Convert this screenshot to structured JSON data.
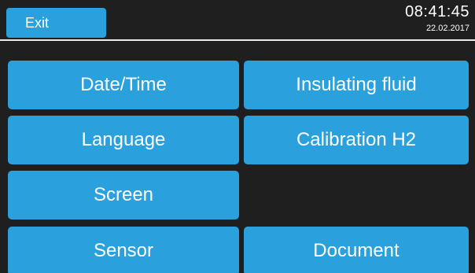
{
  "header": {
    "exit_label": "Exit",
    "time": "08:41:45",
    "date": "22.02.2017"
  },
  "menu": {
    "date_time": "Date/Time",
    "insulating_fluid": "Insulating fluid",
    "language": "Language",
    "calibration_h2": "Calibration H2",
    "screen": "Screen",
    "sensor": "Sensor",
    "document": "Document"
  },
  "colors": {
    "accent": "#2aa0dc",
    "background": "#1f1f1f",
    "text": "#ffffff"
  }
}
